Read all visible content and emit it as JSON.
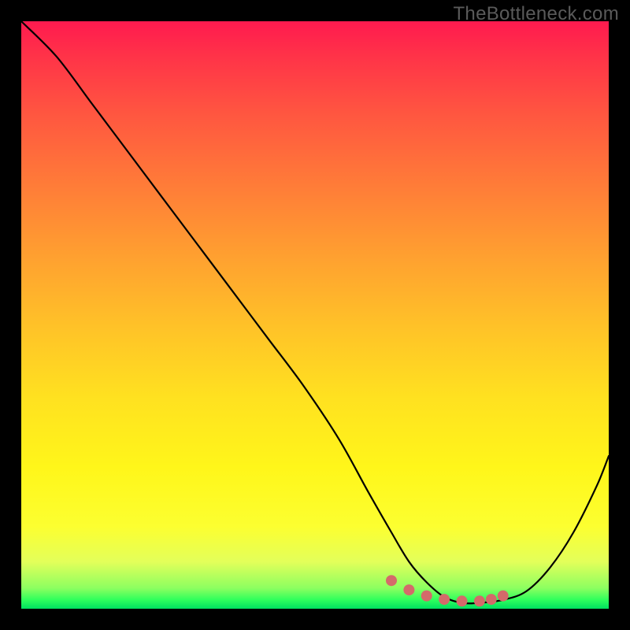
{
  "watermark": "TheBottleneck.com",
  "chart_data": {
    "type": "line",
    "title": "",
    "xlabel": "",
    "ylabel": "",
    "xlim": [
      0,
      100
    ],
    "ylim": [
      0,
      100
    ],
    "series": [
      {
        "name": "bottleneck-curve",
        "x": [
          0,
          6,
          12,
          18,
          24,
          30,
          36,
          42,
          48,
          54,
          59,
          63,
          66,
          69,
          72,
          75,
          78,
          82,
          86,
          90,
          94,
          98,
          100
        ],
        "values": [
          100,
          94,
          86,
          78,
          70,
          62,
          54,
          46,
          38,
          29,
          20,
          13,
          8,
          4.5,
          2,
          1,
          1,
          1.5,
          3,
          7,
          13,
          21,
          26
        ]
      }
    ],
    "markers": {
      "name": "optimal-range-dots",
      "x": [
        63,
        66,
        69,
        72,
        75,
        78,
        80,
        82
      ],
      "values": [
        4.8,
        3.2,
        2.2,
        1.6,
        1.3,
        1.3,
        1.6,
        2.2
      ]
    }
  }
}
